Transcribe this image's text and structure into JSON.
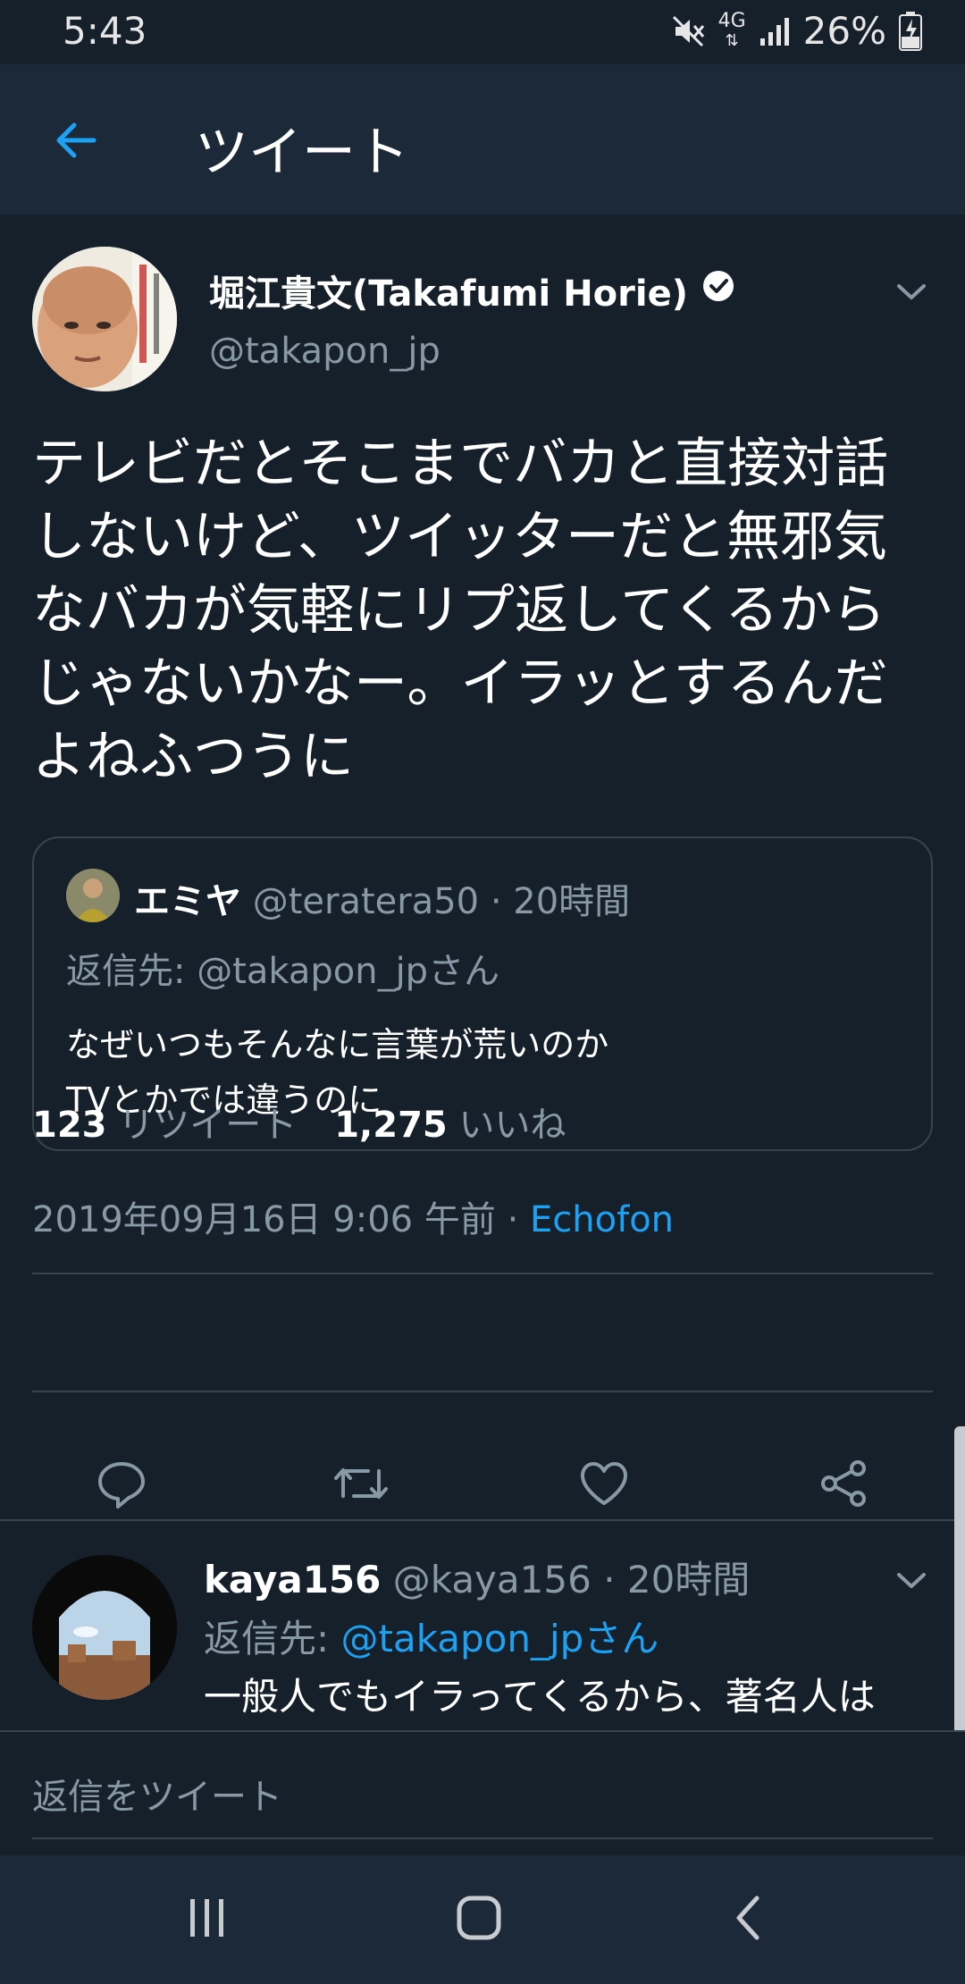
{
  "status_bar": {
    "time": "5:43",
    "network": "4G",
    "battery": "26%",
    "icons": [
      "mute-icon",
      "network-4g-icon",
      "signal-icon",
      "battery-charging-icon"
    ]
  },
  "app_bar": {
    "back_icon": "arrow-left-icon",
    "title": "ツイート"
  },
  "tweet": {
    "author_name": "堀江貴文(Takafumi Horie)",
    "verified": true,
    "author_handle": "@takapon_jp",
    "text": "テレビだとそこまでバカと直接対話しないけど、ツイッターだと無邪気なバカが気軽にリプ返してくるからじゃないかなー。イラッとするんだよねふつうに",
    "quote": {
      "name": "エミヤ",
      "handle": "@teratera50",
      "time": "20時間",
      "reply_to": "返信先: @takapon_jpさん",
      "line1": "なぜいつもそんなに言葉が荒いのか",
      "line2": "TVとかでは違うのに"
    },
    "timestamp": "2019年09月16日 9:06 午前",
    "client": "Echofon",
    "retweets": "123",
    "retweets_label": "リツイート",
    "likes": "1,275",
    "likes_label": "いいね",
    "actions": [
      "reply-icon",
      "retweet-icon",
      "like-icon",
      "share-icon"
    ]
  },
  "reply": {
    "name": "kaya156",
    "handle": "@kaya156",
    "time": "20時間",
    "reply_to_prefix": "返信先: ",
    "reply_to_mention": "@takapon_jpさん",
    "text": "一般人でもイラってくるから、著名人は"
  },
  "compose": {
    "placeholder": "返信をツイート"
  },
  "colors": {
    "background": "#15202b",
    "bar": "#1c2938",
    "accent": "#1da1f2",
    "secondary_text": "#8899a6",
    "divider": "#38444d"
  }
}
